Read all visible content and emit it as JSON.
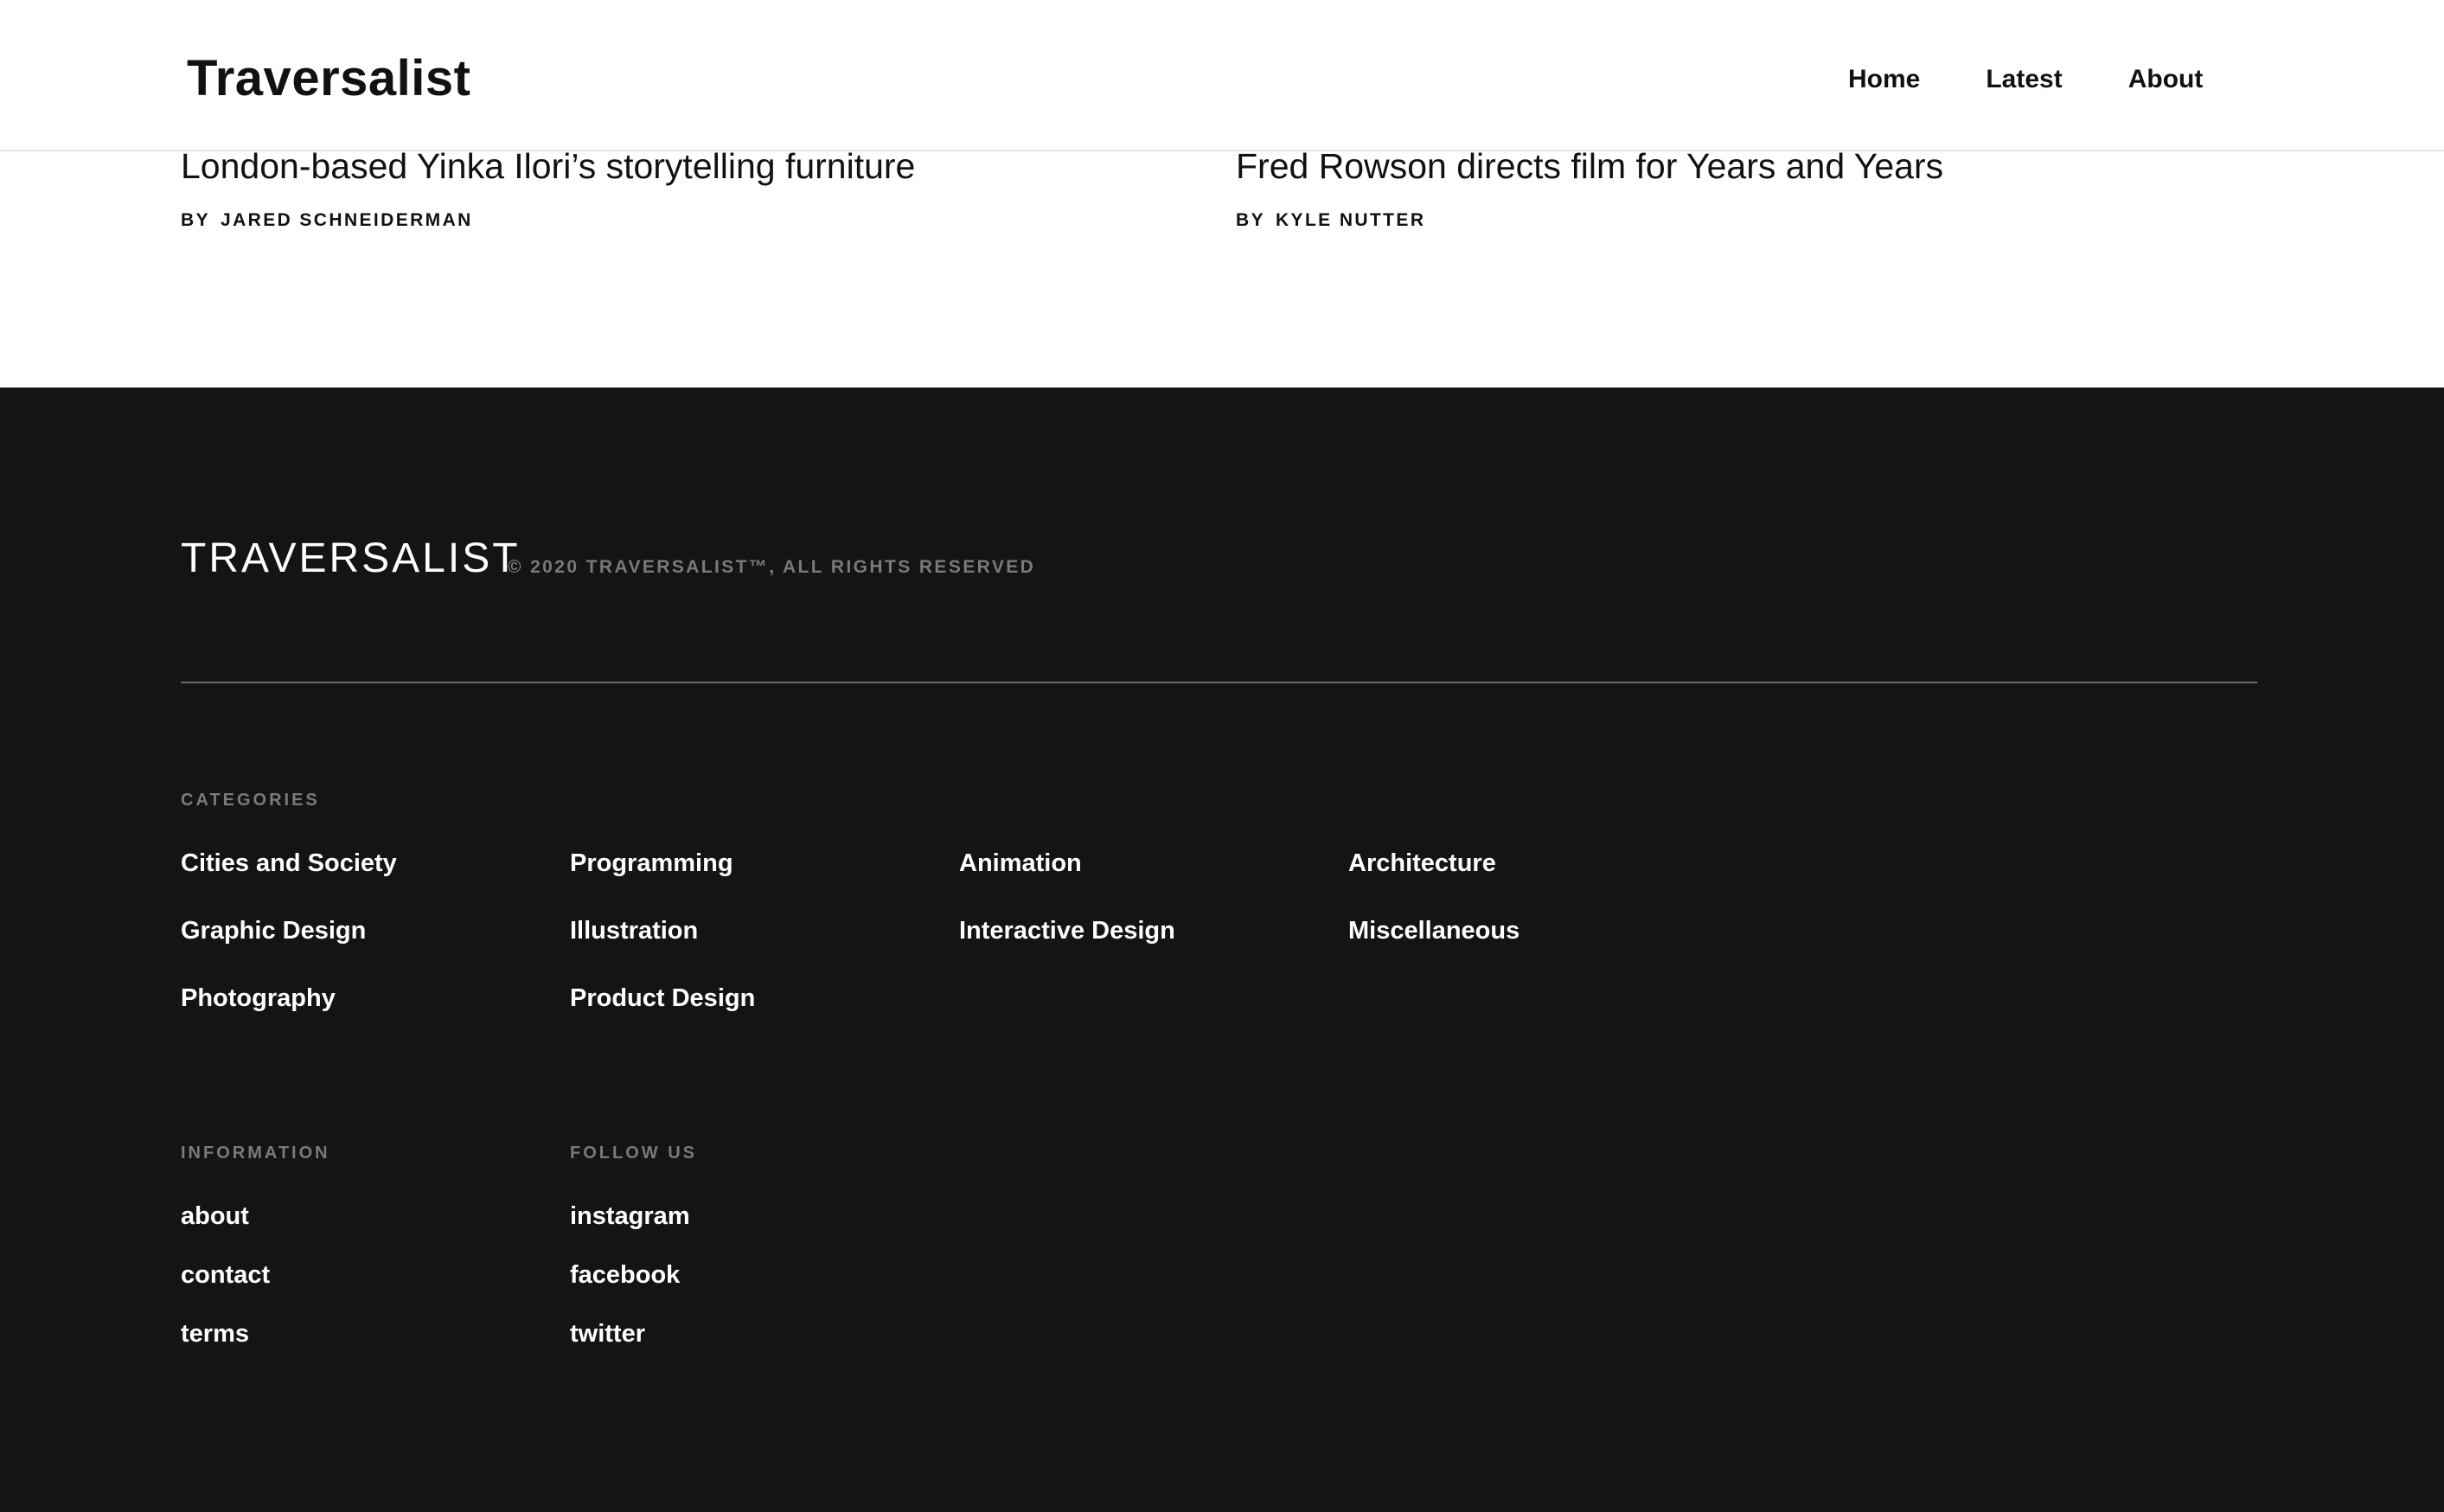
{
  "header": {
    "brand": "Traversalist",
    "nav": [
      "Home",
      "Latest",
      "About"
    ]
  },
  "articles": [
    {
      "title": "London-based Yinka Ilori’s storytelling furniture",
      "by": "BY",
      "author": "JARED SCHNEIDERMAN"
    },
    {
      "title": "Fred Rowson directs film for Years and Years",
      "by": "BY",
      "author": "KYLE NUTTER"
    }
  ],
  "footer": {
    "brand": "TRAVERSALIST",
    "copyright": "© 2020 TRAVERSALIST™, ALL RIGHTS RESERVED",
    "categories_label": "CATEGORIES",
    "categories": [
      [
        "Cities and Society",
        "Graphic Design",
        "Photography"
      ],
      [
        "Programming",
        "Illustration",
        "Product Design"
      ],
      [
        "Animation",
        "Interactive Design"
      ],
      [
        "Architecture",
        "Miscellaneous"
      ]
    ],
    "information_label": "INFORMATION",
    "information": [
      "about",
      "contact",
      "terms"
    ],
    "follow_label": "FOLLOW US",
    "follow": [
      "instagram",
      "facebook",
      "twitter"
    ]
  }
}
